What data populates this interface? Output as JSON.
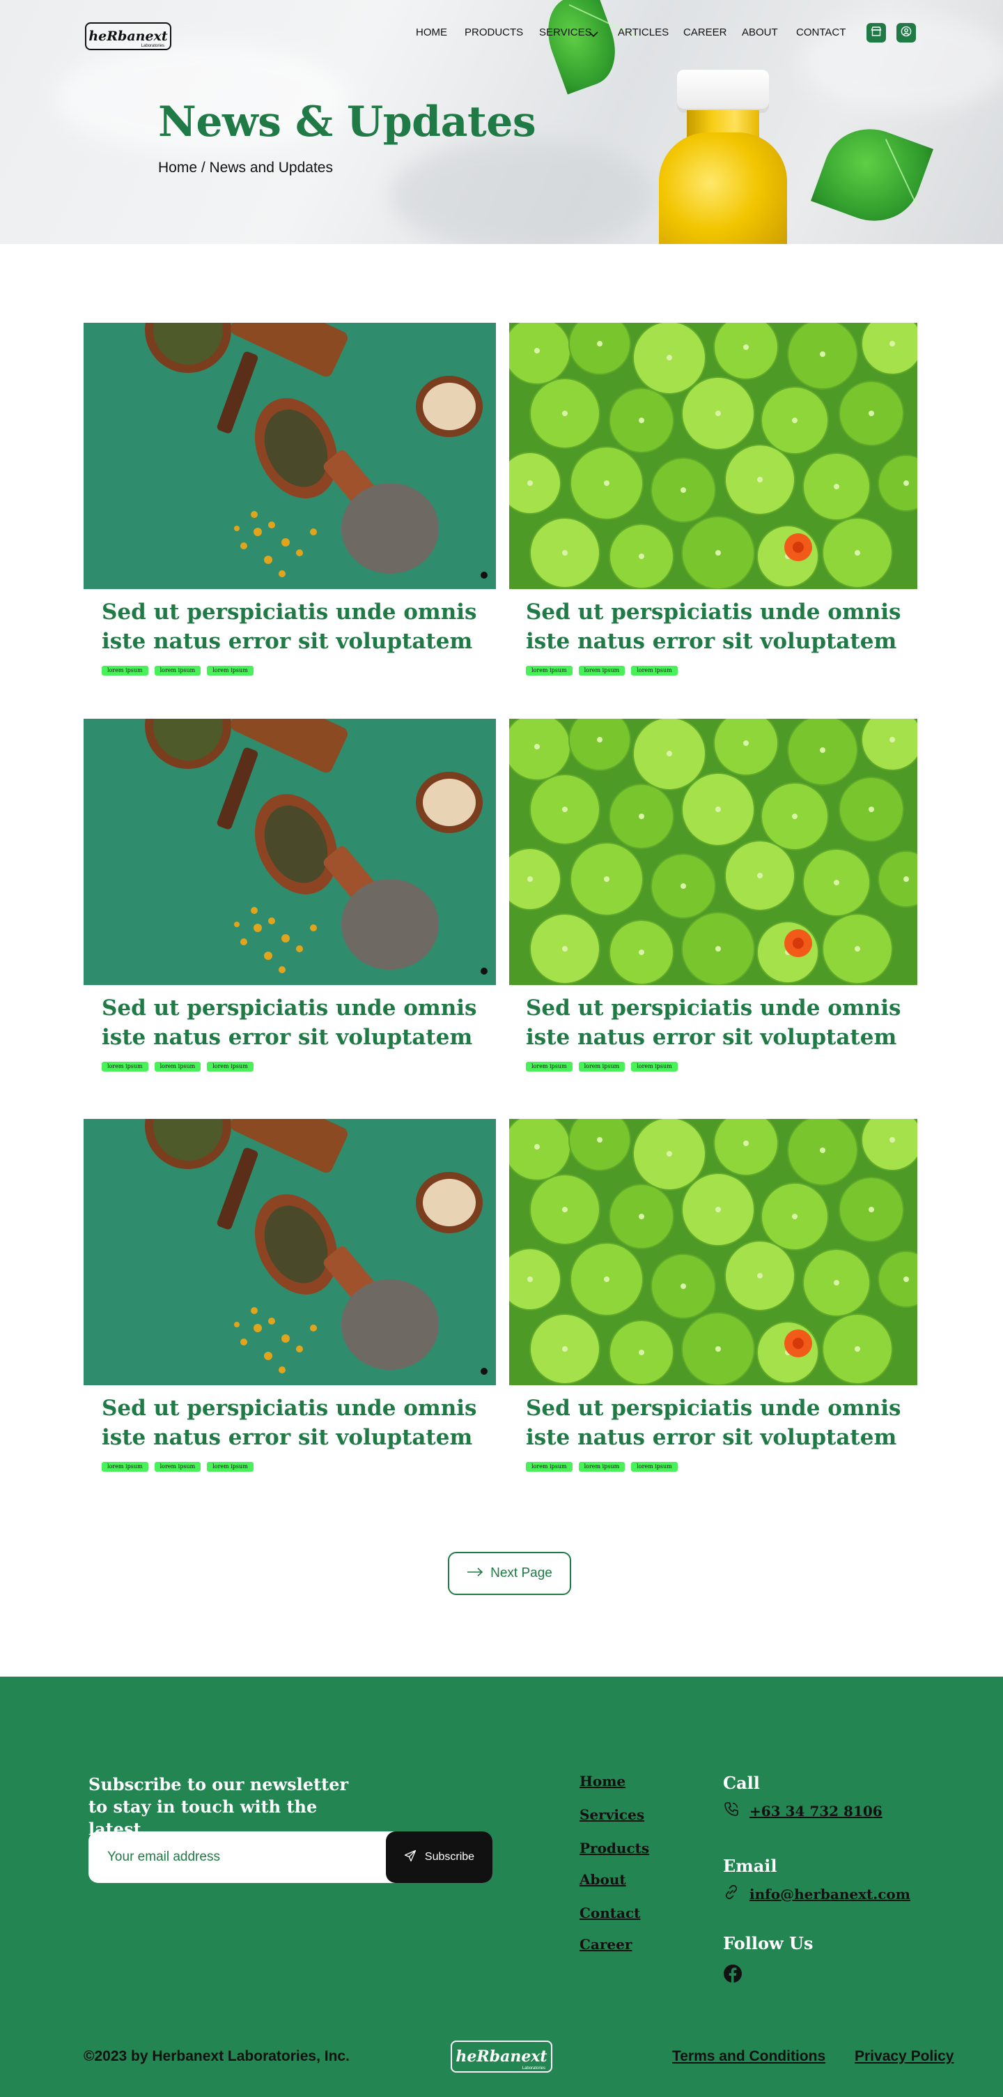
{
  "brand": {
    "logo_text": "heRbanext",
    "logo_sub": "Laboratories"
  },
  "nav": {
    "items": [
      "HOME",
      "PRODUCTS",
      "SERVICES",
      "ARTICLES",
      "CAREER",
      "ABOUT",
      "CONTACT"
    ]
  },
  "hero": {
    "title": "News & Updates",
    "breadcrumb": "Home / News and Updates"
  },
  "articles": [
    {
      "title": "Sed ut perspiciatis unde omnis iste natus error sit voluptatem",
      "tags": [
        "lorem ipsum",
        "lorem ipsum",
        "lorem ipsum"
      ],
      "image": "herbs"
    },
    {
      "title": "Sed ut perspiciatis unde omnis iste natus error sit voluptatem",
      "tags": [
        "lorem ipsum",
        "lorem ipsum",
        "lorem ipsum"
      ],
      "image": "leaves"
    },
    {
      "title": "Sed ut perspiciatis unde omnis iste natus error sit voluptatem",
      "tags": [
        "lorem ipsum",
        "lorem ipsum",
        "lorem ipsum"
      ],
      "image": "herbs"
    },
    {
      "title": "Sed ut perspiciatis unde omnis iste natus error sit voluptatem",
      "tags": [
        "lorem ipsum",
        "lorem ipsum",
        "lorem ipsum"
      ],
      "image": "leaves"
    },
    {
      "title": "Sed ut perspiciatis unde omnis iste natus error sit voluptatem",
      "tags": [
        "lorem ipsum",
        "lorem ipsum",
        "lorem ipsum"
      ],
      "image": "herbs"
    },
    {
      "title": "Sed ut perspiciatis unde omnis iste natus error sit voluptatem",
      "tags": [
        "lorem ipsum",
        "lorem ipsum",
        "lorem ipsum"
      ],
      "image": "leaves"
    }
  ],
  "pagination": {
    "next_label": "Next Page"
  },
  "footer": {
    "newsletter_title": "Subscribe to our newsletter to stay in touch with the latest.",
    "email_placeholder": "Your email address",
    "subscribe_label": "Subscribe",
    "links": [
      "Home",
      "Services",
      "Products",
      "About",
      "Contact",
      "Career"
    ],
    "call_title": "Call",
    "phone": "+63 34 732 8106",
    "email_title": "Email",
    "email": "info@herbanext.com",
    "follow_title": "Follow Us",
    "copyright": "©2023 by Herbanext Laboratories, Inc.",
    "terms": "Terms and Conditions",
    "privacy": "Privacy Policy"
  },
  "colors": {
    "brand_green": "#1f7a45",
    "footer_green": "#238552",
    "tag_green": "#4af05a"
  }
}
